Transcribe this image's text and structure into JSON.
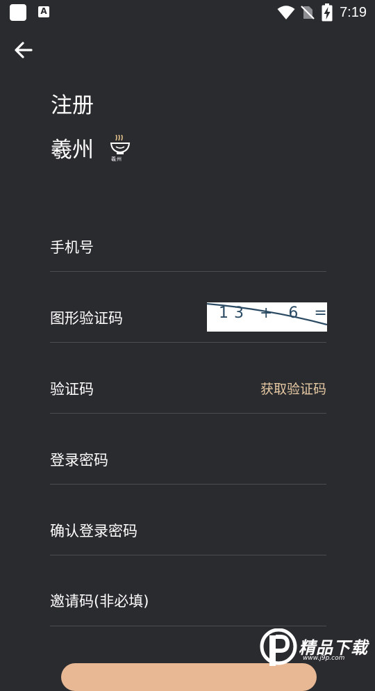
{
  "status_bar": {
    "time": "7:19",
    "a_icon_glyph": "A",
    "icons": [
      "app-square-icon",
      "a-notification-icon",
      "wifi-icon",
      "no-sim-icon",
      "battery-charging-icon"
    ]
  },
  "header": {
    "back_icon": "back-arrow-icon"
  },
  "title": "注册",
  "brand": {
    "name": "羲州",
    "logo_text": "羲州"
  },
  "fields": {
    "phone": {
      "label": "手机号"
    },
    "captcha": {
      "label": "图形验证码",
      "image_text": "13 + 6 ="
    },
    "sms_code": {
      "label": "验证码",
      "action": "获取验证码"
    },
    "password": {
      "label": "登录密码"
    },
    "confirm_password": {
      "label": "确认登录密码"
    },
    "invite_code": {
      "label": "邀请码(非必填)"
    }
  },
  "watermark": {
    "text": "精品下载",
    "url": "www.j9p.com"
  },
  "colors": {
    "background": "#2a2b2f",
    "text": "#ffffff",
    "divider": "#4c4d52",
    "accent": "#e6c9a3",
    "button": "#e8b894"
  }
}
